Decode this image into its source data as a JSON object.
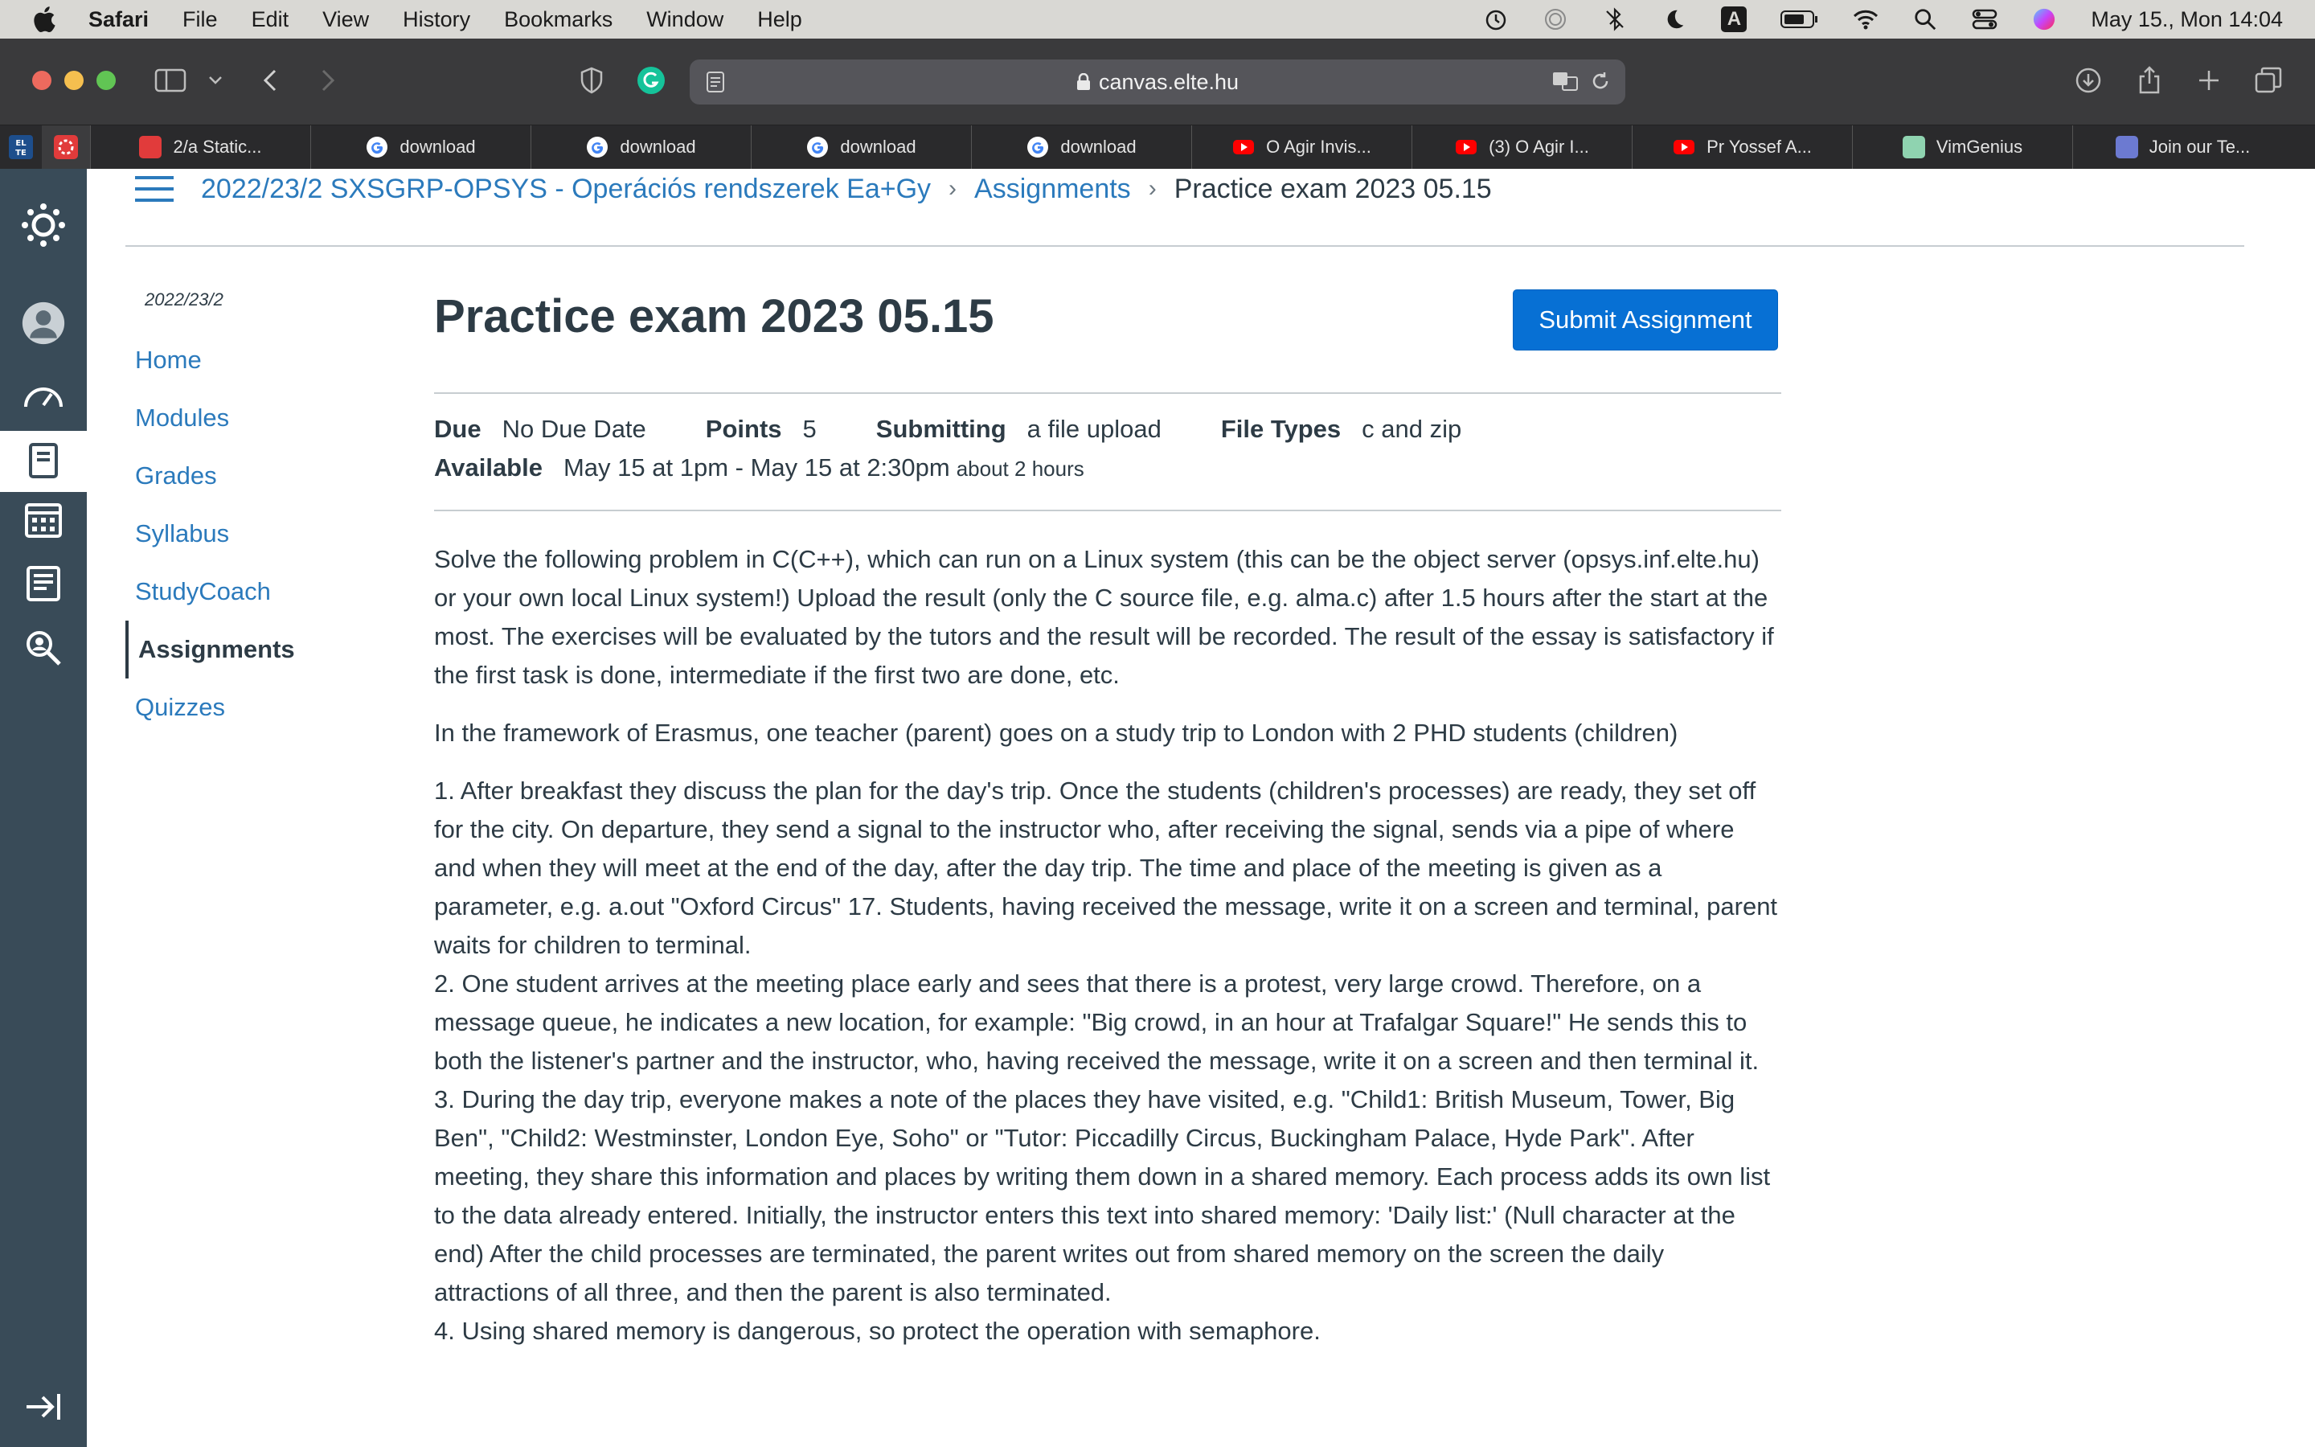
{
  "menubar": {
    "app_name": "Safari",
    "items": [
      "File",
      "Edit",
      "View",
      "History",
      "Bookmarks",
      "Window",
      "Help"
    ],
    "datetime": "May 15., Mon  14:04",
    "input_indicator": "A"
  },
  "browser": {
    "url": "canvas.elte.hu",
    "tabs": [
      {
        "label": "2/a Static...",
        "favicon": "canvas-favicon",
        "color": "#e13b3b"
      },
      {
        "label": "download",
        "favicon": "google-favicon",
        "color": "#ffffff"
      },
      {
        "label": "download",
        "favicon": "google-favicon",
        "color": "#ffffff"
      },
      {
        "label": "download",
        "favicon": "google-favicon",
        "color": "#ffffff"
      },
      {
        "label": "download",
        "favicon": "google-favicon",
        "color": "#ffffff"
      },
      {
        "label": "O Agir Invis...",
        "favicon": "youtube-favicon",
        "color": "#ff0000"
      },
      {
        "label": "(3) O Agir I...",
        "favicon": "youtube-favicon",
        "color": "#ff0000"
      },
      {
        "label": "Pr Yossef A...",
        "favicon": "youtube-favicon",
        "color": "#ff0000"
      },
      {
        "label": "VimGenius",
        "favicon": "vimgenius-favicon",
        "color": "#8fd3b0"
      },
      {
        "label": "Join our Te...",
        "favicon": "grid-favicon",
        "color": "#6c7ad1"
      }
    ],
    "pinned_label": "EL TE"
  },
  "breadcrumb": {
    "course": "2022/23/2 SXSGRP-OPSYS - Operációs rendszerek Ea+Gy",
    "section": "Assignments",
    "current": "Practice exam 2023 05.15"
  },
  "course_nav": {
    "term": "2022/23/2",
    "items": [
      "Home",
      "Modules",
      "Grades",
      "Syllabus",
      "StudyCoach",
      "Assignments",
      "Quizzes"
    ],
    "active": "Assignments"
  },
  "assignment": {
    "title": "Practice exam 2023 05.15",
    "submit_label": "Submit Assignment",
    "due_label": "Due",
    "due_value": "No Due Date",
    "points_label": "Points",
    "points_value": "5",
    "submitting_label": "Submitting",
    "submitting_value": "a file upload",
    "filetypes_label": "File Types",
    "filetypes_value": "c and zip",
    "available_label": "Available",
    "available_value": "May 15 at 1pm - May 15 at 2:30pm",
    "available_duration": "about 2 hours"
  },
  "description": {
    "p1": "Solve the following problem in C(C++), which can run on a Linux system (this can be the object server (opsys.inf.elte.hu) or your own local Linux system!) Upload the result (only the C source file, e.g. alma.c) after 1.5 hours after the start at the most. The exercises will be evaluated by the tutors and the result will be recorded. The result of the essay is satisfactory if the first task is done, intermediate if the first two are done, etc.",
    "p2": "In the framework of Erasmus, one teacher (parent) goes on a study trip to London with 2 PHD students (children)",
    "task1": "1. After breakfast they discuss the plan for the day's trip. Once the students (children's processes) are ready, they set off for the city. On departure, they send a signal to the instructor who, after receiving the signal, sends via a pipe of where and when they will meet at the end of the day, after the day trip. The time and place of the meeting is given as a parameter, e.g. a.out \"Oxford Circus\" 17. Students, having received the message, write it on a screen and terminal, parent waits for children to terminal.",
    "task2": "2. One student arrives at the meeting place early and sees that there is a protest, very large crowd. Therefore, on a message queue, he indicates a new location, for example: \"Big crowd, in an hour at Trafalgar Square!\" He sends this to both the listener's partner and the instructor, who, having received the message, write it on a screen and then terminal it.",
    "task3": "3. During the day trip, everyone makes a note of the places they have visited, e.g. \"Child1: British Museum, Tower, Big Ben\", \"Child2: Westminster, London Eye, Soho\" or \"Tutor: Piccadilly Circus, Buckingham Palace, Hyde Park\". After meeting, they share this information and places by writing them down in a shared memory. Each process adds its own list to the data already entered. Initially, the instructor enters this text into shared memory: 'Daily list:' (Null character at the end) After the child processes are terminated, the parent writes out from shared memory on the screen the daily attractions of all three, and then the parent is also terminated.",
    "task4": "4. Using shared memory is dangerous, so protect the operation with semaphore."
  },
  "colors": {
    "link": "#2b7abc",
    "text": "#2d3b45",
    "global_nav_bg": "#394b58",
    "button": "#0770d4"
  }
}
